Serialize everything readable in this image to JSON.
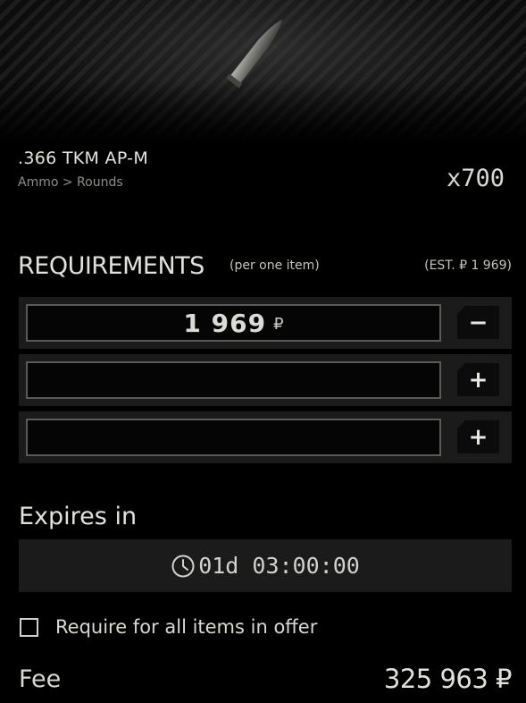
{
  "item": {
    "name": ".366 TKM AP-M",
    "category": "Ammo > Rounds",
    "quantity": "x700",
    "icon": "bullet-icon"
  },
  "requirements": {
    "title": "REQUIREMENTS",
    "note": "(per one item)",
    "estimate": "(EST. ₽ 1 969)",
    "rows": [
      {
        "price": "1 969",
        "currency": "₽",
        "button": "−"
      },
      {
        "price": "",
        "currency": "",
        "button": "+"
      },
      {
        "price": "",
        "currency": "",
        "button": "+"
      }
    ]
  },
  "expires": {
    "title": "Expires in",
    "time": "01d 03:00:00",
    "icon": "clock-icon"
  },
  "option": {
    "label": "Require for all items in offer",
    "checked": false
  },
  "fee": {
    "label": "Fee",
    "value": "325 963 ₽"
  }
}
